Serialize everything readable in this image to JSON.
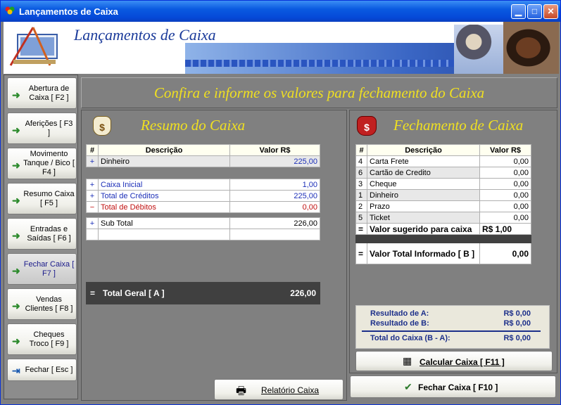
{
  "window": {
    "title": "Lançamentos de Caixa"
  },
  "banner": {
    "title": "Lançamentos de Caixa"
  },
  "sidebar": {
    "items": [
      {
        "label": "Abertura de Caixa  [ F2 ]"
      },
      {
        "label": "Aferições [ F3 ]"
      },
      {
        "label": "Movimento Tanque  / Bico [ F4 ]"
      },
      {
        "label": "Resumo Caixa [ F5 ]"
      },
      {
        "label": "Entradas e Saídas [ F6 ]"
      },
      {
        "label": "Fechar Caixa [ F7 ]"
      },
      {
        "label": "Vendas Clientes [ F8 ]"
      },
      {
        "label": "Cheques Troco [ F9 ]"
      },
      {
        "label": "Fechar [ Esc ]"
      }
    ]
  },
  "header": "Confira e informe os valores para fechamento do Caixa",
  "resumo": {
    "title": "Resumo do Caixa",
    "col_hash": "#",
    "col_desc": "Descrição",
    "col_val": "Valor R$",
    "rows": [
      {
        "sign": "+",
        "desc": "Dinheiro",
        "val": "225,00"
      },
      {
        "sign": "+",
        "desc": "Caixa Inicial",
        "val": "1,00"
      },
      {
        "sign": "+",
        "desc": "Total de Créditos",
        "val": "225,00"
      },
      {
        "sign": "−",
        "desc": "Total de Débitos",
        "val": "0,00"
      },
      {
        "sign": "+",
        "desc": "Sub Total",
        "val": "226,00"
      }
    ],
    "total": {
      "sign": "=",
      "desc": "Total Geral [ A ]",
      "val": "226,00"
    },
    "report_button": "Relatório Caixa"
  },
  "fechamento": {
    "title": "Fechamento de Caixa",
    "col_hash": "#",
    "col_desc": "Descrição",
    "col_val": "Valor R$",
    "rows": [
      {
        "n": "4",
        "desc": "Carta Frete",
        "val": "0,00"
      },
      {
        "n": "6",
        "desc": "Cartão de Credito",
        "val": "0,00"
      },
      {
        "n": "3",
        "desc": "Cheque",
        "val": "0,00"
      },
      {
        "n": "1",
        "desc": "Dinheiro",
        "val": "0,00"
      },
      {
        "n": "2",
        "desc": "Prazo",
        "val": "0,00"
      },
      {
        "n": "5",
        "desc": "Ticket",
        "val": "0,00"
      }
    ],
    "suggested": {
      "sign": "=",
      "desc": "Valor sugerido para caixa",
      "val": "R$ 1,00"
    },
    "informed": {
      "sign": "=",
      "desc": "Valor Total Informado [ B ]",
      "val": "0,00"
    },
    "results": {
      "a_label": "Resultado de A:",
      "a_val": "R$ 0,00",
      "b_label": "Resultado de B:",
      "b_val": "R$ 0,00",
      "t_label": "Total do Caixa (B - A):",
      "t_val": "R$ 0,00"
    },
    "calc_button": "Calcular Caixa [ F11 ]",
    "close_button": "Fechar Caixa [ F10 ]"
  }
}
